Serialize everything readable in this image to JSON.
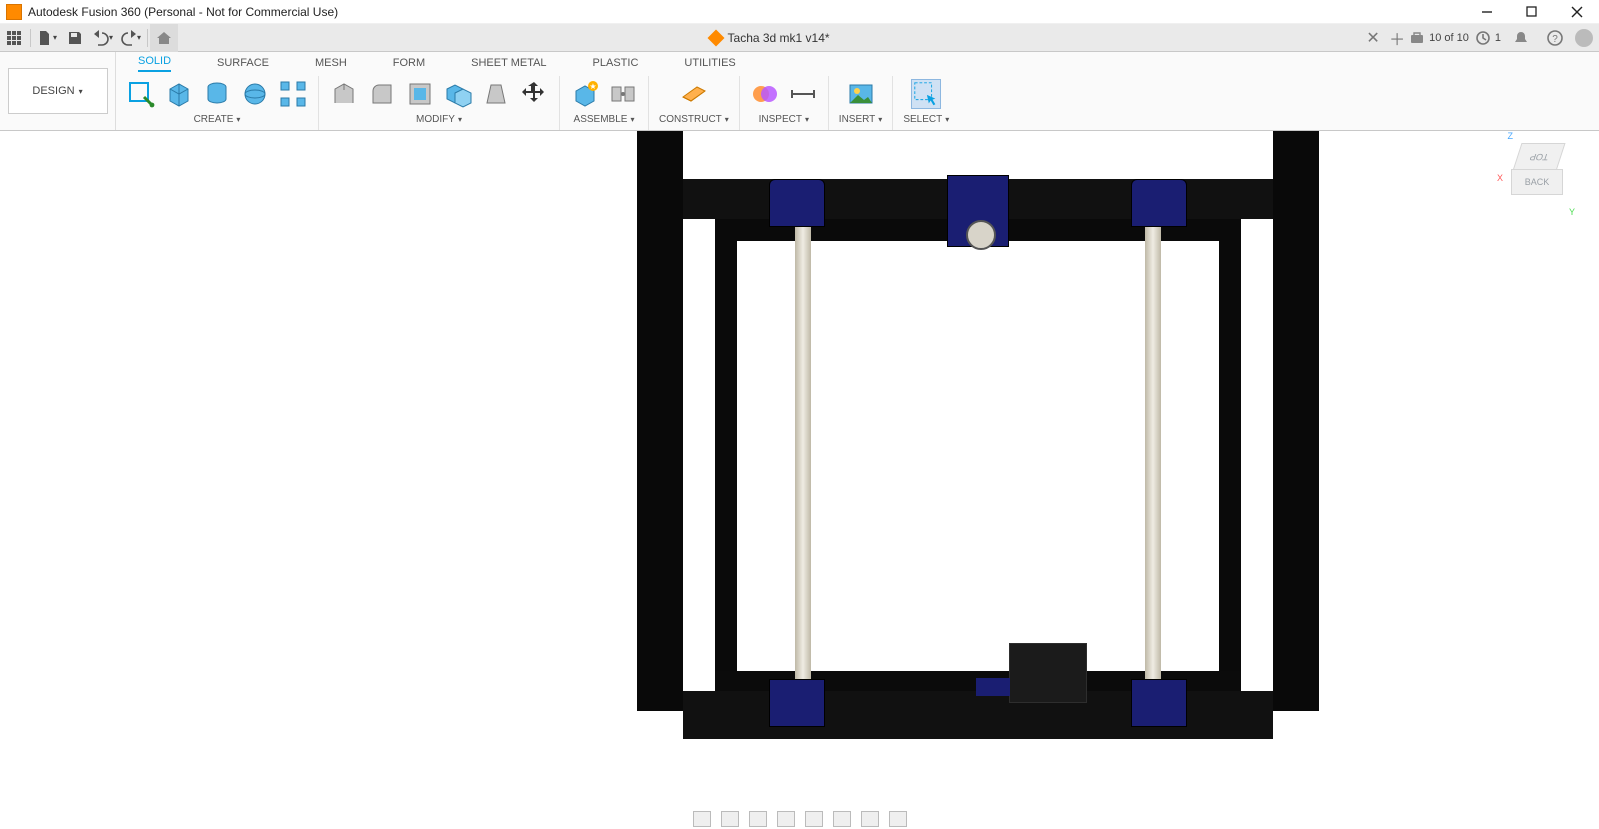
{
  "window": {
    "title": "Autodesk Fusion 360 (Personal - Not for Commercial Use)"
  },
  "document": {
    "name": "Tacha 3d mk1 v14*"
  },
  "status": {
    "save_count": "10 of 10",
    "jobs": "1"
  },
  "workspace": {
    "label": "DESIGN"
  },
  "env_tabs": [
    "SOLID",
    "SURFACE",
    "MESH",
    "FORM",
    "SHEET METAL",
    "PLASTIC",
    "UTILITIES"
  ],
  "env_active": 0,
  "panels": {
    "create": "CREATE",
    "modify": "MODIFY",
    "assemble": "ASSEMBLE",
    "construct": "CONSTRUCT",
    "inspect": "INSPECT",
    "insert": "INSERT",
    "select": "SELECT"
  },
  "viewcube": {
    "top": "TOP",
    "back": "BACK"
  }
}
